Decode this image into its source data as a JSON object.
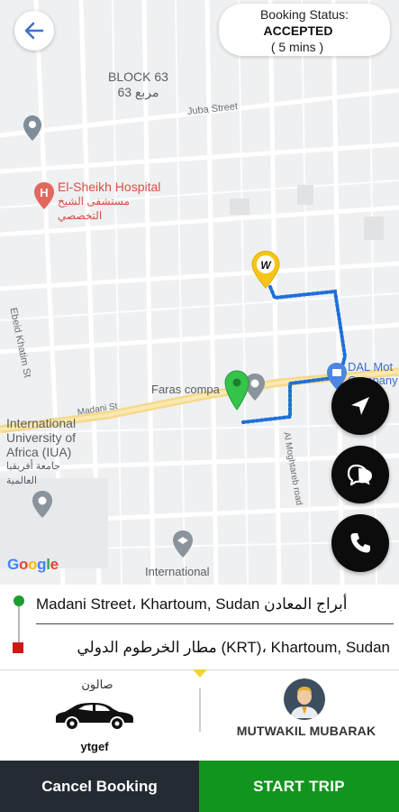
{
  "status": {
    "title": "Booking Status:",
    "value": "ACCEPTED",
    "eta": "( 5 mins )"
  },
  "map": {
    "labels": {
      "block": "BLOCK 63",
      "block_ar": "مربع 63",
      "juba": "Juba Street",
      "hospital": "El-Sheikh Hospital",
      "hospital_ar1": "مستشفى الشيخ",
      "hospital_ar2": "التخصصي",
      "ebeid": "Ebeid Khatim St",
      "madani": "Madani St",
      "faras": "Faras compa",
      "iua1": "International",
      "iua2": "University of",
      "iua3": "Africa (IUA)",
      "iua_ar1": "جامعة أفريقيا",
      "iua_ar2": "العالمية",
      "mogh": "Al Moghtareb road",
      "intl": "International",
      "dal1": "DAL Mot",
      "dal2": "Company"
    },
    "google": [
      "G",
      "o",
      "o",
      "g",
      "l",
      "e"
    ],
    "colors": {
      "route": "#1f6fd9",
      "road_main": "#f6d98a",
      "pickup_pin": "#34c44a",
      "driver_pin": "#f5c518"
    }
  },
  "addresses": {
    "pickup": "Madani Street، Khartoum, Sudan أبراج المعادن",
    "dropoff": "مطار الخرطوم الدولي (KRT)، Khartoum, Sudan"
  },
  "vehicle": {
    "type": "صالون",
    "plate": "ytgef"
  },
  "driver": {
    "name": "MUTWAKIL MUBARAK"
  },
  "actions": {
    "cancel": "Cancel Booking",
    "start": "START TRIP"
  },
  "icons": {
    "back": "arrow-left-icon",
    "locate": "navigation-arrow-icon",
    "chat": "chat-bubbles-icon",
    "call": "phone-icon"
  }
}
